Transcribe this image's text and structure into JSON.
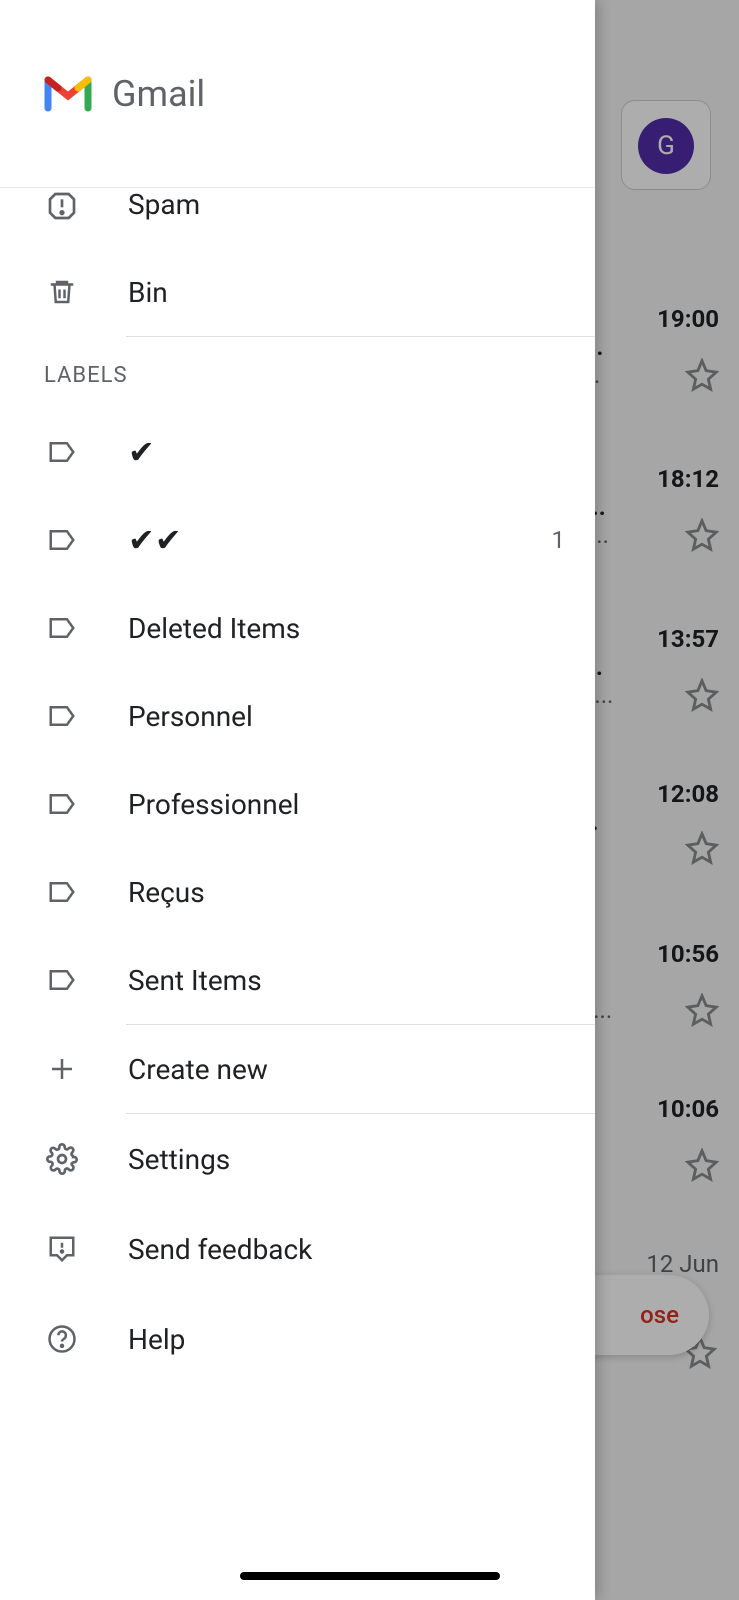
{
  "header": {
    "app_title": "Gmail"
  },
  "background": {
    "avatar_initial": "G",
    "compose_label": "ose",
    "rows": [
      {
        "time": "19:00",
        "snip1": "b...",
        "snip2": "s..."
      },
      {
        "time": "18:12",
        "snip1": "&...",
        "snip2": "at..."
      },
      {
        "time": "13:57",
        "snip1": "e...",
        "snip2": "oil..."
      },
      {
        "time": "12:08",
        "snip1": " f...",
        "snip2": ""
      },
      {
        "time": "10:56",
        "snip1": "",
        "snip2": "w!..."
      },
      {
        "time": "10:06",
        "snip1": "'...",
        "snip2": "..."
      }
    ],
    "last_date": "12 Jun"
  },
  "drawer": {
    "system_folders": [
      {
        "label": "Spam",
        "icon": "spam"
      },
      {
        "label": "Bin",
        "icon": "trash"
      }
    ],
    "labels_header": "LABELS",
    "labels": [
      {
        "label": "✔",
        "count": null
      },
      {
        "label": "✔✔",
        "count": "1"
      },
      {
        "label": "Deleted Items",
        "count": null
      },
      {
        "label": "Personnel",
        "count": null
      },
      {
        "label": "Professionnel",
        "count": null
      },
      {
        "label": "Reçus",
        "count": null
      },
      {
        "label": "Sent Items",
        "count": null
      }
    ],
    "create_new": "Create new",
    "footer": [
      {
        "label": "Settings",
        "icon": "gear"
      },
      {
        "label": "Send feedback",
        "icon": "feedback"
      },
      {
        "label": "Help",
        "icon": "help"
      }
    ]
  }
}
